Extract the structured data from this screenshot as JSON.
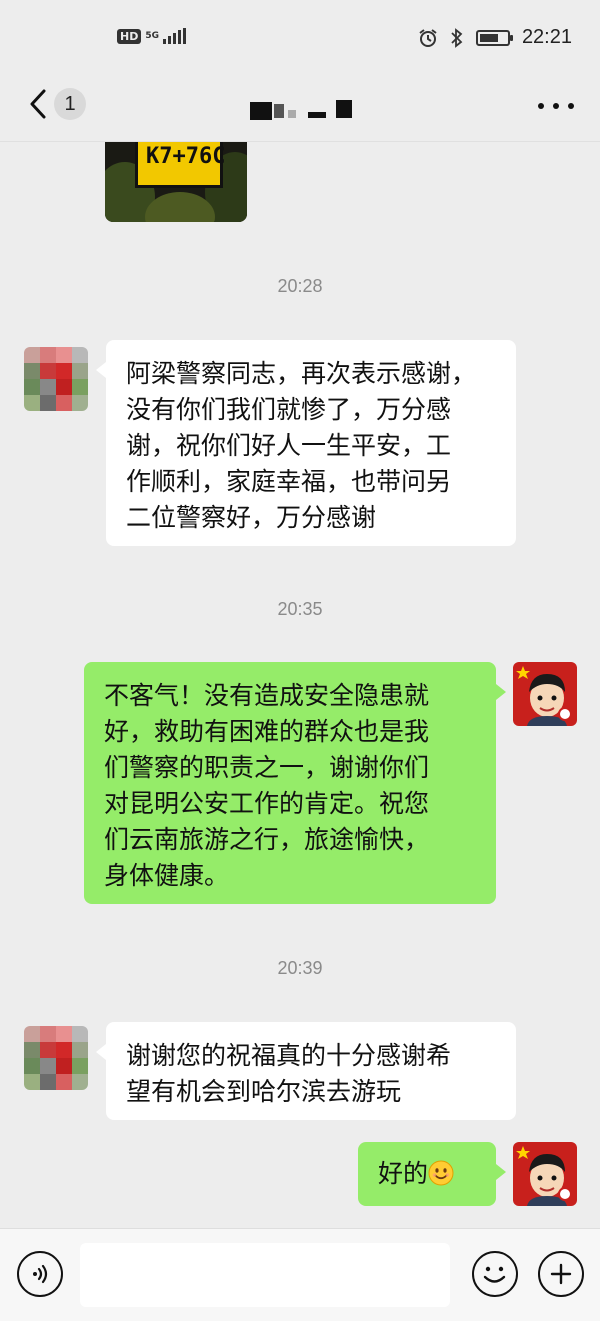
{
  "status_bar": {
    "left_badge": "HD",
    "network": "5G",
    "time": "22:21",
    "icons": [
      "alarm-icon",
      "bluetooth-icon",
      "battery-icon"
    ]
  },
  "nav": {
    "unread_count": "1",
    "back_icon": "chevron-left-icon",
    "more_icon": "more-dots-icon"
  },
  "image_message": {
    "sign_text": "K7+76C"
  },
  "timestamps": [
    "20:28",
    "20:35",
    "20:39"
  ],
  "messages": [
    {
      "direction": "in",
      "lines": [
        "阿梁警察同志，再次表示感谢，",
        "没有你们我们就惨了，万分感",
        "谢，祝你们好人一生平安，工",
        "作顺利，家庭幸福，也带问另",
        "二位警察好，万分感谢"
      ]
    },
    {
      "direction": "out",
      "lines": [
        "不客气！没有造成安全隐患就",
        "好，救助有困难的群众也是我",
        "们警察的职责之一，谢谢你们",
        "对昆明公安工作的肯定。祝您",
        "们云南旅游之行，旅途愉快，",
        "身体健康。"
      ]
    },
    {
      "direction": "in",
      "lines": [
        "谢谢您的祝福真的十分感谢希",
        "望有机会到哈尔滨去游玩"
      ]
    },
    {
      "direction": "out",
      "text": "好的",
      "emoji": "smiley-face-icon"
    }
  ],
  "input_bar": {
    "icons": [
      "voice-icon",
      "emoji-icon",
      "plus-icon"
    ]
  },
  "colors": {
    "background": "#ededed",
    "bubble_in": "#ffffff",
    "bubble_out": "#95ec69",
    "timestamp": "#8a8a8a"
  }
}
